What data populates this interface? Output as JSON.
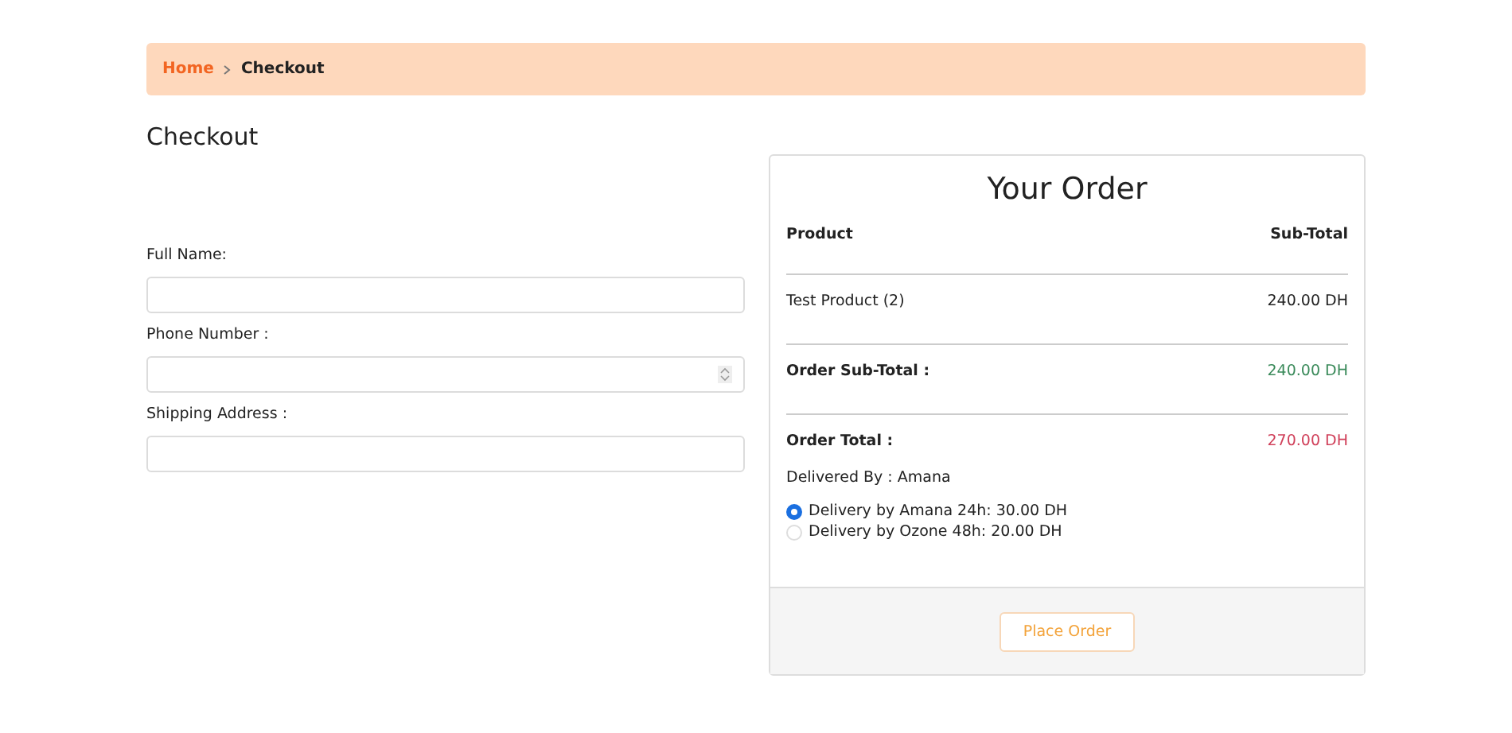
{
  "breadcrumb": [
    {
      "label": "Home",
      "selected": false
    },
    {
      "label": "Checkout",
      "selected": true
    }
  ],
  "heading": "Checkout",
  "form": {
    "fields": [
      {
        "label": "Full Name:",
        "kind": "text"
      },
      {
        "label": "Phone Number :",
        "kind": "number"
      },
      {
        "label": "Shipping Address :",
        "kind": "text"
      }
    ]
  },
  "order": {
    "title": "Your Order",
    "columns": [
      "Product",
      "Sub-Total"
    ],
    "rows": [
      {
        "kind": "item",
        "label": "Test Product (2)",
        "value": "240.00 DH"
      },
      {
        "kind": "subtotal",
        "label": "Order Sub-Total :",
        "value": "240.00 DH"
      },
      {
        "kind": "total",
        "label": "Order Total :",
        "value": "270.00 DH"
      }
    ],
    "delivered_by": "Delivered By : Amana",
    "delivery_options": [
      {
        "label": "Delivery by Amana 24h: 30.00 DH",
        "selected": true
      },
      {
        "label": "Delivery by Ozone 48h: 20.00 DH",
        "selected": false
      }
    ],
    "button": "Place Order"
  }
}
